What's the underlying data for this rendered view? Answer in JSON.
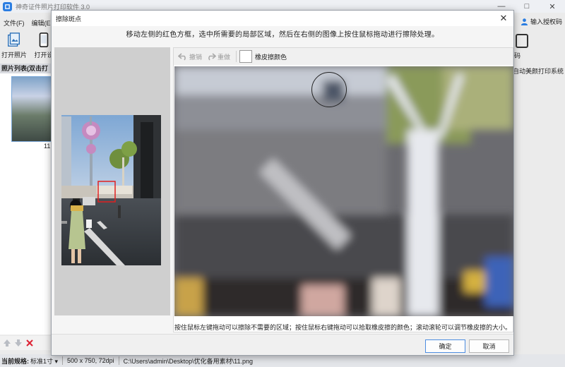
{
  "app": {
    "title": "神奇证件照片打印软件 3.0"
  },
  "menu": {
    "file": "文件(F)",
    "edit": "编辑(E"
  },
  "toolbar": {
    "open_photo": "打开照片",
    "open_other": "打开设",
    "right_label": "码"
  },
  "header_right": {
    "auth": "输入授权码"
  },
  "photo_list": {
    "header": "照片列表(双击打",
    "caption": "11"
  },
  "right_side": {
    "system_label": "自动美颜打印系统"
  },
  "status": {
    "spec_label": "当前规格:",
    "spec_value": "标准1寸",
    "image_info": "500 x 750, 72dpi",
    "path": "C:\\Users\\admin\\Desktop\\优化备用素材\\11.png"
  },
  "dialog": {
    "title": "擦除斑点",
    "instruction": "移动左侧的红色方框，选中所需要的局部区域，然后在右侧的图像上按住鼠标拖动进行擦除处理。",
    "undo_label": "撤销",
    "redo_label": "重做",
    "eraser_color_label": "橡皮擦颜色",
    "hint": "按住鼠标左键拖动可以擦除不需要的区域；按住鼠标右键拖动可以拾取橡皮擦的颜色；滚动滚轮可以调节橡皮擦的大小。",
    "ok_label": "确定",
    "cancel_label": "取消"
  },
  "colors": {
    "accent": "#2a7de1",
    "selection_box": "#e02020",
    "eraser_color": "#ffffff"
  }
}
